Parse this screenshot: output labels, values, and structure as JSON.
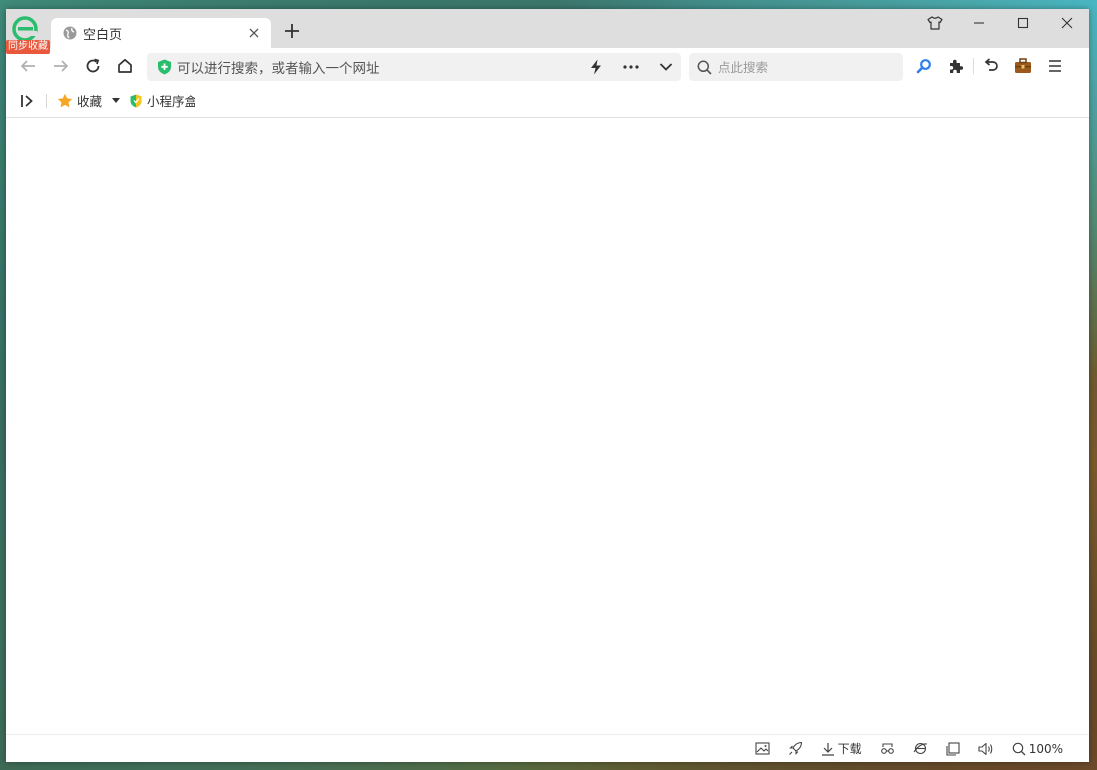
{
  "brand": {
    "badge": "同步收藏",
    "logo_icon": "browser-e-logo-icon"
  },
  "tab": {
    "title": "空白页",
    "favicon": "globe-icon"
  },
  "window_controls": [
    "skin-icon",
    "minimize-icon",
    "maximize-icon",
    "close-icon"
  ],
  "address": {
    "placeholder": "可以进行搜索，或者输入一个网址",
    "security_icon": "shield-plus-icon"
  },
  "search": {
    "placeholder": "点此搜索"
  },
  "bookmarks": {
    "favorites_label": "收藏",
    "mini_program_label": "小程序盒"
  },
  "status": {
    "download_label": "下载",
    "zoom": "100%"
  },
  "colors": {
    "brand_green": "#2bbd6e",
    "badge_red": "#e9573c",
    "star": "#f5a623",
    "search_blue": "#2f80ed"
  }
}
